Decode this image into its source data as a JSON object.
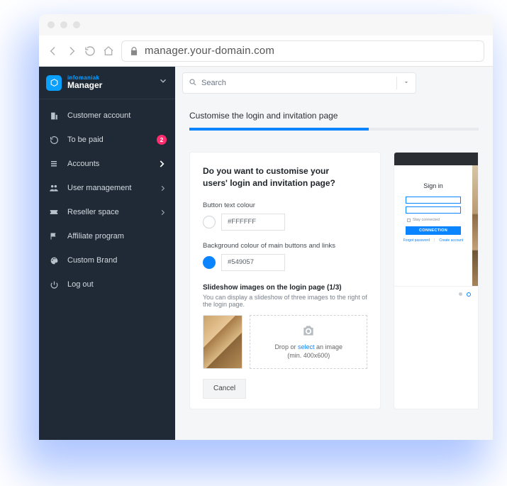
{
  "address_bar": {
    "url": "manager.your-domain.com"
  },
  "brand": {
    "company": "infomaniak",
    "product": "Manager"
  },
  "sidebar": {
    "items": [
      {
        "label": "Customer account",
        "badge": null,
        "chevron": false
      },
      {
        "label": "To be paid",
        "badge": "2",
        "chevron": false
      },
      {
        "label": "Accounts",
        "badge": null,
        "chevron": true
      },
      {
        "label": "User management",
        "badge": null,
        "chevron": true
      },
      {
        "label": "Reseller space",
        "badge": null,
        "chevron": true
      },
      {
        "label": "Affiliate program",
        "badge": null,
        "chevron": false
      },
      {
        "label": "Custom Brand",
        "badge": null,
        "chevron": false
      },
      {
        "label": "Log out",
        "badge": null,
        "chevron": false
      }
    ]
  },
  "search": {
    "placeholder": "Search"
  },
  "page": {
    "title": "Customise the login and invitation page",
    "card_heading": "Do you want to customise your users' login and invitation page?",
    "labels": {
      "button_text_colour": "Button text colour",
      "background_colour": "Background colour of main buttons and links",
      "slideshow_title": "Slideshow images on the login page (1/3)",
      "slideshow_sub": "You can display a slideshow of three images to the right of the login page."
    },
    "values": {
      "button_text_colour": "#FFFFFF",
      "background_colour": "#549057"
    },
    "dropzone": {
      "line1_pre": "Drop or ",
      "line1_link": "select",
      "line1_post": " an image",
      "line2": "(min. 400x600)"
    },
    "buttons": {
      "cancel": "Cancel"
    }
  },
  "preview": {
    "signin": "Sign in",
    "stay_connected": "Stay connected",
    "connection_btn": "CONNECTION",
    "link_forgot": "Forgot password",
    "link_create": "Create account"
  },
  "colors": {
    "accent": "#0a84ff",
    "sidebar_bg": "#1f2a36",
    "badge": "#ff2d6e"
  }
}
